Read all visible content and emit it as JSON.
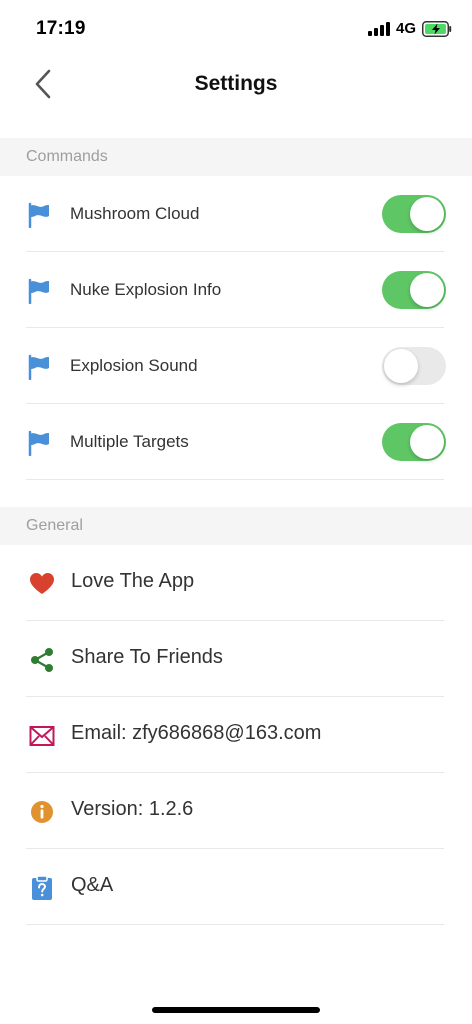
{
  "status_bar": {
    "time": "17:19",
    "network": "4G"
  },
  "nav": {
    "title": "Settings",
    "back_icon": "chevron-left-icon"
  },
  "sections": {
    "commands": {
      "header": "Commands",
      "items": [
        {
          "label": "Mushroom Cloud",
          "icon": "flag-icon",
          "enabled": true
        },
        {
          "label": "Nuke Explosion Info",
          "icon": "flag-icon",
          "enabled": true
        },
        {
          "label": "Explosion Sound",
          "icon": "flag-icon",
          "enabled": false
        },
        {
          "label": "Multiple Targets",
          "icon": "flag-icon",
          "enabled": true
        }
      ]
    },
    "general": {
      "header": "General",
      "items": [
        {
          "label": "Love The App",
          "icon": "heart-icon"
        },
        {
          "label": "Share To Friends",
          "icon": "share-icon"
        },
        {
          "label": "Email: zfy686868@163.com",
          "icon": "mail-icon"
        },
        {
          "label": "Version: 1.2.6",
          "icon": "info-icon"
        },
        {
          "label": "Q&A",
          "icon": "question-icon"
        }
      ]
    }
  },
  "colors": {
    "toggle_on": "#5ec664",
    "toggle_off": "#e9e9ea",
    "flag": "#4a90d9",
    "heart": "#d9412f",
    "share": "#2e7d32",
    "mail": "#c2185b",
    "info": "#e0922f",
    "question": "#4a90d9"
  }
}
